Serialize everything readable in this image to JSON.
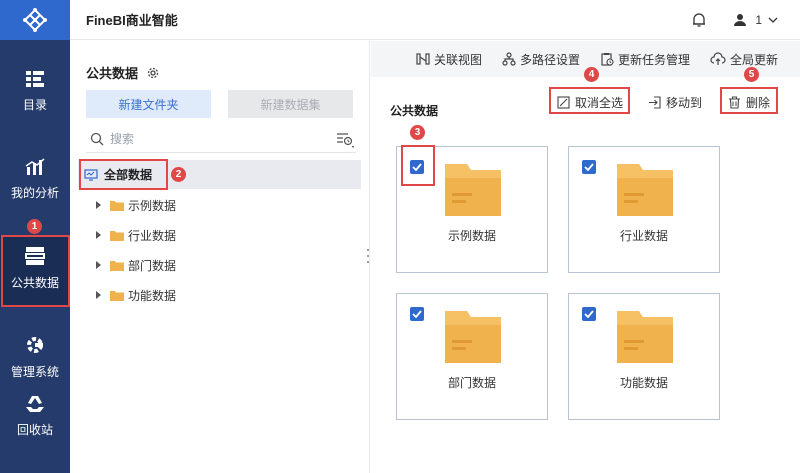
{
  "app": {
    "title": "FineBI商业智能"
  },
  "user": {
    "name": "1"
  },
  "nav": {
    "items": [
      {
        "label": "目录",
        "icon": "catalog-icon"
      },
      {
        "label": "我的分析",
        "icon": "analysis-icon"
      },
      {
        "label": "公共数据",
        "icon": "public-data-icon",
        "active": true
      },
      {
        "label": "管理系统",
        "icon": "management-icon"
      },
      {
        "label": "回收站",
        "icon": "recycle-bin-icon"
      }
    ]
  },
  "left": {
    "title": "公共数据",
    "new_folder": "新建文件夹",
    "new_dataset": "新建数据集",
    "search_placeholder": "搜索",
    "tree_root": "全部数据",
    "tree_items": [
      "示例数据",
      "行业数据",
      "部门数据",
      "功能数据"
    ]
  },
  "toolbar": {
    "relation_view": "关联视图",
    "multi_path": "多路径设置",
    "update_task": "更新任务管理",
    "global_update": "全局更新"
  },
  "main": {
    "section_title": "公共数据",
    "deselect_all": "取消全选",
    "move_to": "移动到",
    "delete": "删除",
    "cards": [
      "示例数据",
      "行业数据",
      "部门数据",
      "功能数据"
    ]
  },
  "badges": [
    "1",
    "2",
    "3",
    "4",
    "5"
  ],
  "colors": {
    "nav_bg": "#243b6b",
    "logo_bg": "#2f69ce",
    "accent": "#2f69ce",
    "folder": "#f0b24d",
    "annotation": "#e04848"
  }
}
